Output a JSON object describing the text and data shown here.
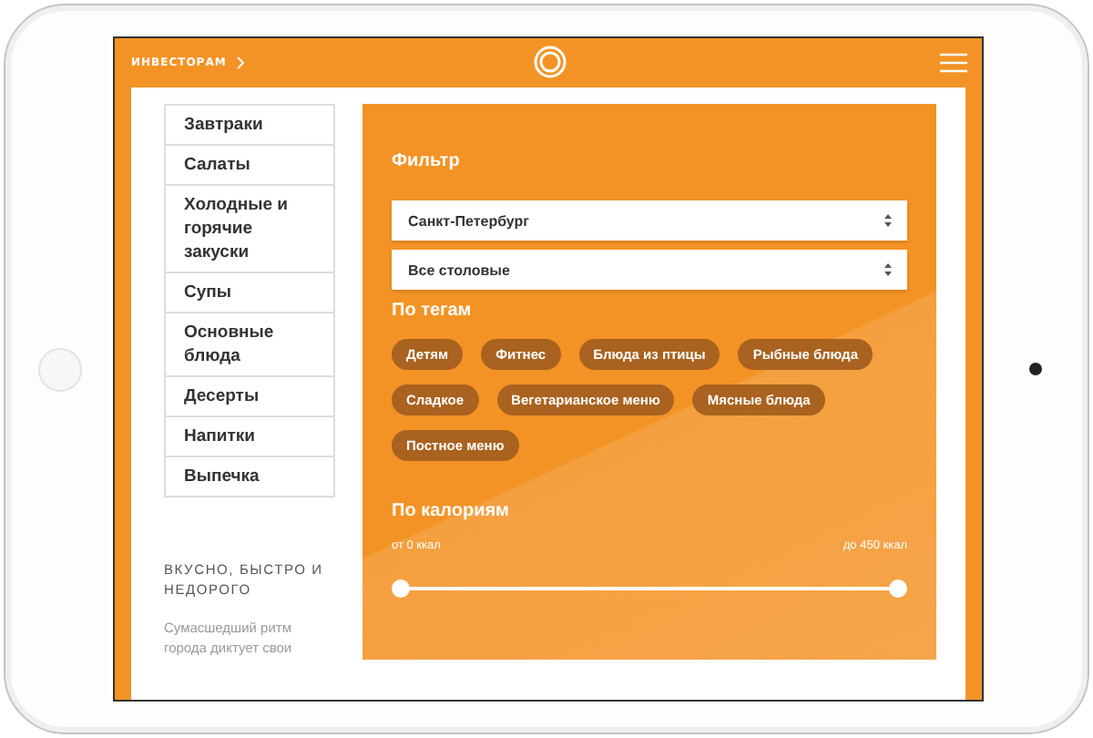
{
  "header": {
    "link": "ИНВЕСТОРАМ"
  },
  "sidebar": {
    "items": [
      {
        "label": "Завтраки",
        "selected": false
      },
      {
        "label": "Салаты",
        "selected": false
      },
      {
        "label": "Холодные и горячие закуски",
        "selected": false
      },
      {
        "label": "Супы",
        "selected": false
      },
      {
        "label": "Основные блюда",
        "selected": false
      },
      {
        "label": "Десерты",
        "selected": false
      },
      {
        "label": "Напитки",
        "selected": false
      },
      {
        "label": "Выпечка",
        "selected": false
      }
    ],
    "heading": "ВКУСНО, БЫСТРО И НЕДОРОГО",
    "text": "Сумасшедший ритм города диктует свои"
  },
  "filter": {
    "title": "Фильтр",
    "selects": [
      {
        "value": "Санкт-Петербург"
      },
      {
        "value": "Все столовые"
      }
    ],
    "tags_title": "По тегам",
    "tags": [
      {
        "label": "Детям"
      },
      {
        "label": "Фитнес"
      },
      {
        "label": "Блюда из птицы"
      },
      {
        "label": "Рыбные блюда"
      },
      {
        "label": "Сладкое"
      },
      {
        "label": "Вегетарианское меню"
      },
      {
        "label": "Мясные блюда"
      },
      {
        "label": "Постное меню"
      }
    ],
    "calories_title": "По калориям",
    "from_label": "от 0 ккал",
    "to_label": "до 450 ккал",
    "thumbs": [
      {
        "level": 0
      },
      {
        "level": 1
      }
    ]
  }
}
